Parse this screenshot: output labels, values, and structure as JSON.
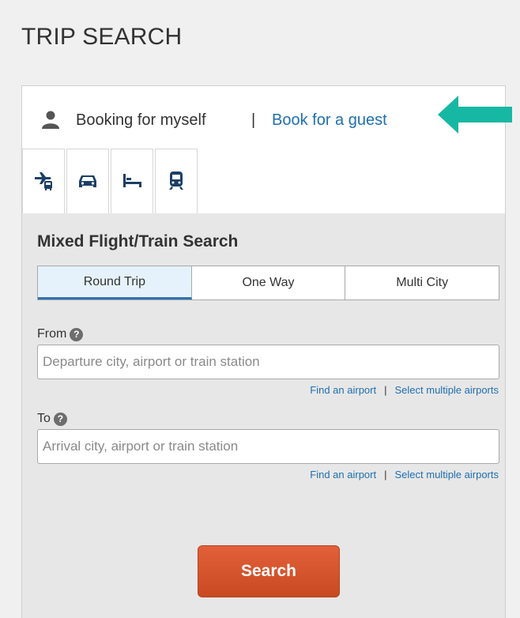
{
  "page": {
    "title": "TRIP SEARCH"
  },
  "booking": {
    "self_label": "Booking for myself",
    "separator": "|",
    "guest_link": "Book for a guest"
  },
  "tabs": [
    {
      "icon": "flight-train-icon"
    },
    {
      "icon": "car-icon"
    },
    {
      "icon": "hotel-bed-icon"
    },
    {
      "icon": "train-icon"
    }
  ],
  "search": {
    "heading": "Mixed Flight/Train Search",
    "trip_types": [
      "Round Trip",
      "One Way",
      "Multi City"
    ],
    "selected_trip_type": "Round Trip",
    "from": {
      "label": "From",
      "placeholder": "Departure city, airport or train station",
      "value": ""
    },
    "to": {
      "label": "To",
      "placeholder": "Arrival city, airport or train station",
      "value": ""
    },
    "links": {
      "find_airport": "Find an airport",
      "separator": "|",
      "select_multiple": "Select multiple airports"
    },
    "submit_label": "Search"
  },
  "colors": {
    "link": "#1f6fb0",
    "accent_arrow": "#17b8a3",
    "search_button": "#d45430",
    "tab_icon": "#1c3f66"
  }
}
